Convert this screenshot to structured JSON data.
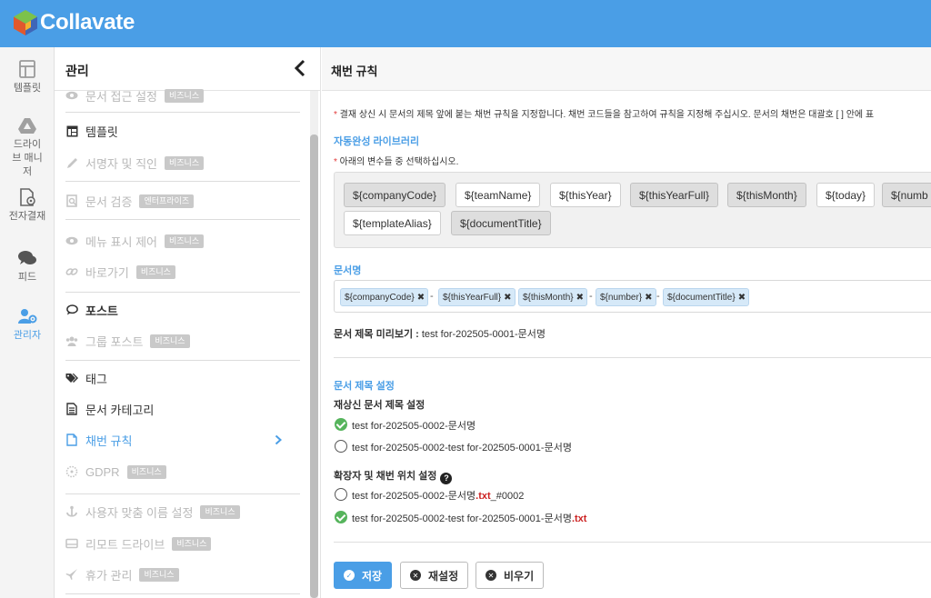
{
  "app": {
    "name": "Collavate",
    "accent": "#4a9ee6"
  },
  "rail": [
    {
      "label": "템플릿",
      "icon": "template-icon"
    },
    {
      "label": "드라이브 매니저",
      "icon": "drive-icon"
    },
    {
      "label": "전자결재",
      "icon": "approval-icon"
    },
    {
      "label": "피드",
      "icon": "chat-icon"
    },
    {
      "label": "관리자",
      "icon": "admin-icon",
      "active": true
    }
  ],
  "panel": {
    "title": "관리",
    "items": [
      {
        "label": "문서 접근 설정",
        "badge": "비즈니스",
        "disabled": true,
        "icon": "eye-icon"
      },
      {
        "label": "템플릿",
        "icon": "template-icon"
      },
      {
        "label": "서명자 및 직인",
        "badge": "비즈니스",
        "disabled": true,
        "icon": "pen-icon"
      },
      {
        "label": "문서 검증",
        "badge": "엔터프라이즈",
        "disabled": true,
        "icon": "search-doc-icon"
      },
      {
        "label": "메뉴 표시 제어",
        "badge": "비즈니스",
        "disabled": true,
        "icon": "eye-icon"
      },
      {
        "label": "바로가기",
        "badge": "비즈니스",
        "disabled": true,
        "icon": "link-icon"
      },
      {
        "label": "포스트",
        "icon": "comment-icon"
      },
      {
        "label": "그룹 포스트",
        "badge": "비즈니스",
        "disabled": true,
        "icon": "group-icon"
      },
      {
        "label": "태그",
        "icon": "tag-icon"
      },
      {
        "label": "문서 카테고리",
        "icon": "document-icon"
      },
      {
        "label": "채번 규칙",
        "icon": "file-icon",
        "selected": true
      },
      {
        "label": "GDPR",
        "badge": "비즈니스",
        "disabled": true,
        "icon": "gdpr-icon"
      },
      {
        "label": "사용자 맞춤 이름 설정",
        "badge": "비즈니스",
        "disabled": true,
        "icon": "anchor-icon"
      },
      {
        "label": "리모트 드라이브",
        "badge": "비즈니스",
        "disabled": true,
        "icon": "drive-icon"
      },
      {
        "label": "휴가 관리",
        "badge": "비즈니스",
        "disabled": true,
        "icon": "plane-icon"
      }
    ]
  },
  "main": {
    "title": "채번 규칙",
    "description": "결재 상신 시 문서의 제목 앞에 붙는 채번 규칙을 지정합니다. 채번 코드들을 참고하여 규칙을 지정해 주십시오. 문서의 채번은 대괄호 [ ] 안에 표",
    "autocomplete": {
      "title": "자동완성 라이브러리",
      "hint": "아래의 변수들 중 선택하십시오.",
      "tags": [
        {
          "label": "${companyCode}",
          "used": true
        },
        {
          "label": "${teamName}",
          "used": false
        },
        {
          "label": "${thisYear}",
          "used": false
        },
        {
          "label": "${thisYearFull}",
          "used": true
        },
        {
          "label": "${thisMonth}",
          "used": true
        },
        {
          "label": "${today}",
          "used": false
        },
        {
          "label": "${numb",
          "used": true
        },
        {
          "label": "${templateAlias}",
          "used": false
        },
        {
          "label": "${documentTitle}",
          "used": true
        }
      ]
    },
    "doc_name": {
      "title": "문서명",
      "chips": [
        "${companyCode}",
        "${thisYearFull}",
        "${thisMonth}",
        "${number}",
        "${documentTitle}"
      ],
      "separator": "-",
      "remove_symbol": "✖"
    },
    "preview": {
      "label": "문서 제목 미리보기 :",
      "value": "test for-202505-0001-문서명"
    },
    "title_settings": {
      "title": "문서 제목 설정",
      "resubmit_title": "재상신 문서 제목 설정",
      "resubmit_options": [
        {
          "text": "test for-202505-0002-문서명",
          "checked": true
        },
        {
          "text": "test for-202505-0002-test for-202505-0001-문서명",
          "checked": false
        }
      ],
      "ext_title": "확장자 및 채번 위치 설정",
      "help": "?",
      "ext_options": [
        {
          "prefix": "test for-202505-0002-문서명",
          "ext": ".txt",
          "suffix": "_#0002",
          "checked": false
        },
        {
          "prefix": "test for-202505-0002-test for-202505-0001-문서명",
          "ext": ".txt",
          "suffix": "",
          "checked": true
        }
      ]
    },
    "buttons": {
      "save": "저장",
      "reset": "재설정",
      "clear": "비우기"
    }
  }
}
